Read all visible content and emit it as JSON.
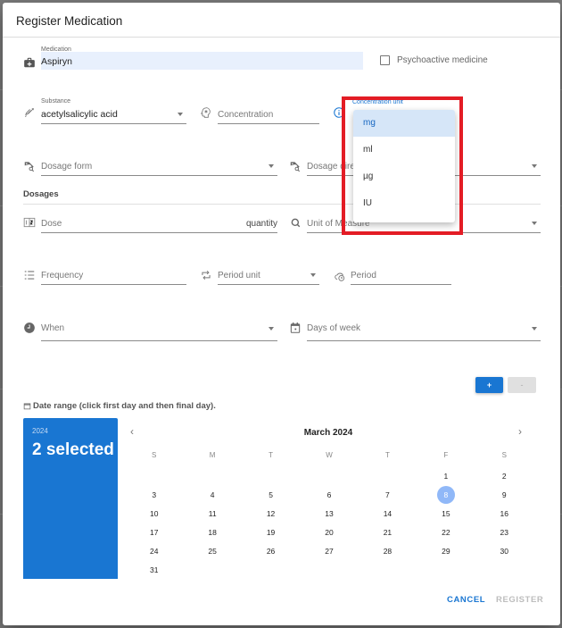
{
  "dialog": {
    "title": "Register Medication"
  },
  "medication": {
    "label": "Medication",
    "value": "Aspiryn",
    "icon": "medical-bag-icon"
  },
  "psychoactive": {
    "label": "Psychoactive medicine",
    "checked": false
  },
  "substance": {
    "label": "Substance",
    "value": "acetylsalicylic acid",
    "icon": "syringe-icon"
  },
  "concentration": {
    "placeholder": "Concentration",
    "icon": "head-asterisk-icon"
  },
  "concentration_unit": {
    "label": "Concentration unit",
    "icon": "info-circle-icon",
    "options": [
      "mg",
      "ml",
      "µg",
      "IU"
    ],
    "highlighted": "mg"
  },
  "dosage_form": {
    "placeholder": "Dosage form",
    "icon": "tag-search-icon"
  },
  "dosage_direction": {
    "placeholder": "Dosage direction",
    "icon": "tag-search-icon"
  },
  "dosages_section": {
    "label": "Dosages"
  },
  "dose": {
    "placeholder": "Dose",
    "suffix": "quantity",
    "icon": "numeric-icon"
  },
  "unit_of_measure": {
    "placeholder": "Unit of Measure",
    "icon": "search-icon"
  },
  "frequency": {
    "placeholder": "Frequency",
    "icon": "list-icon"
  },
  "period_unit": {
    "placeholder": "Period unit",
    "icon": "repeat-icon"
  },
  "period": {
    "placeholder": "Period",
    "icon": "cloud-clock-icon"
  },
  "when": {
    "placeholder": "When",
    "icon": "clock-icon"
  },
  "days_of_week": {
    "placeholder": "Days of week",
    "icon": "calendar-icon"
  },
  "buttons": {
    "add": "+",
    "remove": "-",
    "cancel": "CANCEL",
    "register": "REGISTER"
  },
  "date_range": {
    "label": "Date range (click first day and then final day).",
    "year": "2024",
    "selected_text": "2 selected",
    "month_title": "March 2024",
    "weekdays": [
      "S",
      "M",
      "T",
      "W",
      "T",
      "F",
      "S"
    ],
    "weeks": [
      [
        "",
        "",
        "",
        "",
        "",
        "1",
        "2"
      ],
      [
        "3",
        "4",
        "5",
        "6",
        "7",
        "8",
        "9"
      ],
      [
        "10",
        "11",
        "12",
        "13",
        "14",
        "15",
        "16"
      ],
      [
        "17",
        "18",
        "19",
        "20",
        "21",
        "22",
        "23"
      ],
      [
        "24",
        "25",
        "26",
        "27",
        "28",
        "29",
        "30"
      ],
      [
        "31",
        "",
        "",
        "",
        "",
        "",
        ""
      ]
    ],
    "selected_day": "8"
  },
  "colors": {
    "primary": "#1976d2",
    "highlight_box": "#e31c25",
    "selected_day": "#90b8f8",
    "medication_bg": "#e8f0fd"
  }
}
